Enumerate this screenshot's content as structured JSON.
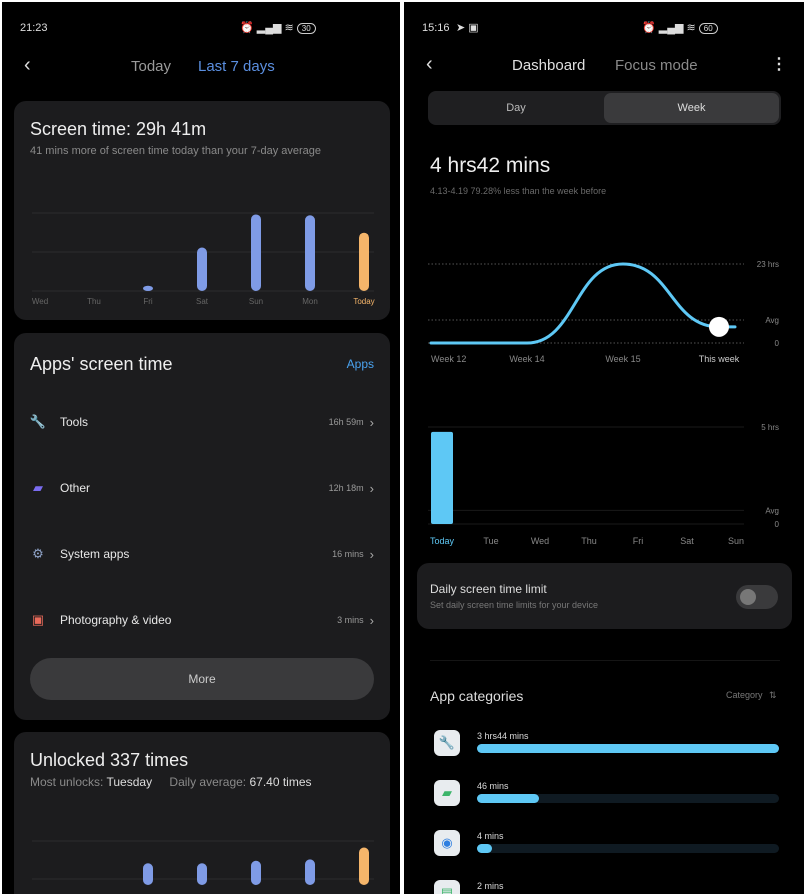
{
  "left": {
    "status": {
      "time": "21:23",
      "battery": "30"
    },
    "nav": {
      "tabs": [
        "Today",
        "Last 7 days"
      ],
      "active": "Last 7 days"
    },
    "screen_time": {
      "title": "Screen time: 29h 41m",
      "subtitle": "41 mins more of screen time today than your 7-day average"
    },
    "apps": {
      "title": "Apps' screen time",
      "link": "Apps",
      "items": [
        {
          "name": "Tools",
          "time": "16h 59m",
          "icon": "wrench-icon",
          "color": "#4aa3f0"
        },
        {
          "name": "Other",
          "time": "12h 18m",
          "icon": "stack-icon",
          "color": "#7a6cf0"
        },
        {
          "name": "System apps",
          "time": "16 mins",
          "icon": "gear-icon",
          "color": "#8fa3c8"
        },
        {
          "name": "Photography & video",
          "time": "3 mins",
          "icon": "photo-icon",
          "color": "#e86a5a"
        }
      ],
      "more": "More"
    },
    "unlocks": {
      "title": "Unlocked 337 times",
      "most_label": "Most unlocks: ",
      "most_value": "Tuesday",
      "avg_label": "Daily average: ",
      "avg_value": "67.40 times"
    }
  },
  "right": {
    "status": {
      "time": "15:16",
      "battery": "60"
    },
    "nav": {
      "tabs": [
        "Dashboard",
        "Focus mode"
      ],
      "active": "Dashboard"
    },
    "segment": {
      "options": [
        "Day",
        "Week"
      ],
      "active": "Week"
    },
    "total": "4 hrs42 mins",
    "range": "4.13-4.19",
    "compare": "79.28% less than the week before",
    "limit": {
      "title": "Daily screen time limit",
      "subtitle": "Set daily screen time limits for your device",
      "enabled": false
    },
    "categories": {
      "title": "App categories",
      "sort": "Category",
      "items": [
        {
          "time": "3 hrs44 mins",
          "fraction": 1.0,
          "icon": "wrench-icon",
          "color": "#3a8ee6"
        },
        {
          "time": "46 mins",
          "fraction": 0.205,
          "icon": "stack-icon",
          "color": "#3cb56a"
        },
        {
          "time": "4 mins",
          "fraction": 0.018,
          "icon": "search-icon",
          "color": "#2f7fe0"
        },
        {
          "time": "2 mins",
          "fraction": 0.009,
          "icon": "chat-icon",
          "color": "#3cb56a"
        }
      ]
    }
  },
  "chart_data": [
    {
      "type": "bar",
      "categories": [
        "Wed",
        "Thu",
        "Fri",
        "Sat",
        "Sun",
        "Mon",
        "Today"
      ],
      "values": [
        0,
        0,
        0.6,
        5.0,
        8.8,
        8.7,
        6.7
      ],
      "highlight": "Today",
      "colors": {
        "bar": "#7f9be6",
        "highlight": "#f5b56a"
      },
      "ylim": [
        0,
        9
      ],
      "grid": true
    },
    {
      "type": "bar",
      "categories": [
        "Wed",
        "Thu",
        "Fri",
        "Sat",
        "Sun",
        "Mon",
        "Today"
      ],
      "values": [
        0,
        0,
        45,
        45,
        52,
        56,
        90
      ],
      "highlight": "Today",
      "colors": {
        "bar": "#7f9be6",
        "highlight": "#f5b56a"
      },
      "grid": true
    },
    {
      "type": "line",
      "categories": [
        "Week 12",
        "Week 14",
        "Week 15",
        "This week"
      ],
      "values": [
        0,
        0,
        23,
        4.7
      ],
      "ylabels": [
        "23 hrs",
        "Avg",
        "0"
      ],
      "yvalues": [
        23,
        6.7,
        0
      ],
      "color": "#5ec8f5"
    },
    {
      "type": "bar",
      "categories": [
        "Today",
        "Tue",
        "Wed",
        "Thu",
        "Fri",
        "Sat",
        "Sun"
      ],
      "values": [
        4.75,
        0,
        0,
        0,
        0,
        0,
        0
      ],
      "ylabels": [
        "5 hrs",
        "Avg",
        "0"
      ],
      "yvalues": [
        5,
        0.7,
        0
      ],
      "color": "#5ec8f5"
    }
  ]
}
